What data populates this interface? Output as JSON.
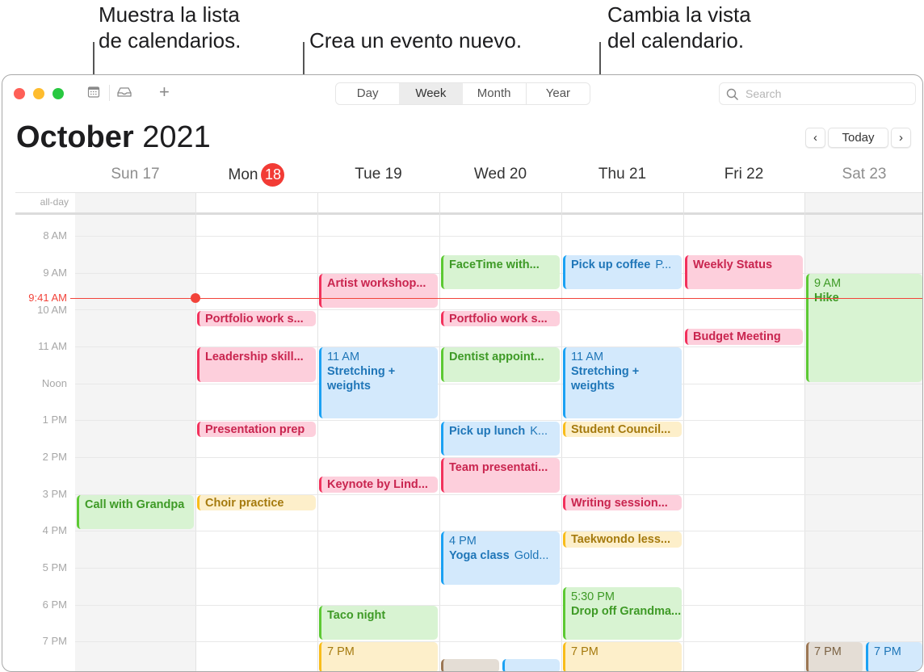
{
  "callouts": {
    "calendar_list": [
      "Muestra la lista",
      "de calendarios."
    ],
    "new_event": "Crea un evento nuevo.",
    "change_view": [
      "Cambia la vista",
      "del calendario."
    ]
  },
  "toolbar": {
    "view_options": [
      "Day",
      "Week",
      "Month",
      "Year"
    ],
    "active_view": "Week",
    "search_placeholder": "Search",
    "add_symbol": "+"
  },
  "header": {
    "month": "October",
    "year": "2021",
    "today_label": "Today",
    "prev_symbol": "‹",
    "next_symbol": "›"
  },
  "days": [
    {
      "label": "Sun 17",
      "weekend": true
    },
    {
      "label": "Mon",
      "badge": "18",
      "today": true
    },
    {
      "label": "Tue 19"
    },
    {
      "label": "Wed 20"
    },
    {
      "label": "Thu 21"
    },
    {
      "label": "Fri 22"
    },
    {
      "label": "Sat 23",
      "weekend": true
    }
  ],
  "all_day_label": "all-day",
  "hours": [
    "8 AM",
    "9 AM",
    "10 AM",
    "11 AM",
    "Noon",
    "1 PM",
    "2 PM",
    "3 PM",
    "4 PM",
    "5 PM",
    "6 PM",
    "7 PM"
  ],
  "current_time": "9:41 AM",
  "colors": {
    "pink": "#f2315c",
    "green": "#5cc933",
    "blue": "#1ba1f3",
    "yellow": "#f8bc1a",
    "brown": "#9b7653",
    "now": "#f2433a"
  },
  "events": [
    {
      "day": 0,
      "start": 15.05,
      "end": 16.0,
      "title": "Call with Grandpa",
      "color": "green"
    },
    {
      "day": 1,
      "start": 10.05,
      "end": 10.5,
      "title": "Portfolio work s...",
      "color": "pink"
    },
    {
      "day": 1,
      "start": 11.05,
      "end": 12.0,
      "title": "Leadership skill...",
      "color": "pink"
    },
    {
      "day": 1,
      "start": 13.05,
      "end": 13.5,
      "title": "Presentation prep",
      "color": "pink"
    },
    {
      "day": 1,
      "start": 15.05,
      "end": 15.5,
      "title": "Choir practice",
      "color": "yellow"
    },
    {
      "day": 2,
      "start": 9.05,
      "end": 10.0,
      "title": "Artist workshop...",
      "color": "pink"
    },
    {
      "day": 2,
      "start": 11.05,
      "end": 13.0,
      "time": "11 AM",
      "title": "Stretching + weights",
      "color": "blue",
      "wrap": true
    },
    {
      "day": 2,
      "start": 14.55,
      "end": 15.0,
      "title": "Keynote by Lind...",
      "color": "pink"
    },
    {
      "day": 2,
      "start": 18.05,
      "end": 19.0,
      "title": "Taco night",
      "color": "green"
    },
    {
      "day": 2,
      "start": 19.05,
      "end": 20.0,
      "time": "7 PM",
      "title": "",
      "color": "yellow"
    },
    {
      "day": 3,
      "start": 8.55,
      "end": 9.5,
      "title": "FaceTime with...",
      "color": "green"
    },
    {
      "day": 3,
      "start": 10.05,
      "end": 10.5,
      "title": "Portfolio work s...",
      "color": "pink"
    },
    {
      "day": 3,
      "start": 11.05,
      "end": 12.0,
      "title": "Dentist appoint...",
      "color": "green"
    },
    {
      "day": 3,
      "start": 13.05,
      "end": 14.0,
      "title": "Pick up lunch",
      "location": "K...",
      "color": "blue"
    },
    {
      "day": 3,
      "start": 14.05,
      "end": 15.0,
      "title": "Team presentati...",
      "color": "pink"
    },
    {
      "day": 3,
      "start": 16.05,
      "end": 17.5,
      "time": "4 PM",
      "title": "Yoga class",
      "location": "Gold...",
      "color": "blue"
    },
    {
      "day": 4,
      "start": 8.55,
      "end": 9.5,
      "title": "Pick up coffee",
      "location": "P...",
      "color": "blue"
    },
    {
      "day": 4,
      "start": 11.05,
      "end": 13.0,
      "time": "11 AM",
      "title": "Stretching + weights",
      "color": "blue",
      "wrap": true
    },
    {
      "day": 4,
      "start": 13.05,
      "end": 13.5,
      "title": "Student Council...",
      "color": "yellow"
    },
    {
      "day": 4,
      "start": 15.05,
      "end": 15.5,
      "title": "Writing session...",
      "color": "pink"
    },
    {
      "day": 4,
      "start": 16.05,
      "end": 16.5,
      "title": "Taekwondo less...",
      "color": "yellow"
    },
    {
      "day": 4,
      "start": 17.55,
      "end": 19.0,
      "time": "5:30 PM",
      "title": "Drop off Grandma...",
      "color": "green",
      "wrap": true
    },
    {
      "day": 4,
      "start": 19.05,
      "end": 20.0,
      "time": "7 PM",
      "title": "",
      "color": "yellow"
    },
    {
      "day": 5,
      "start": 8.55,
      "end": 9.5,
      "title": "Weekly Status",
      "color": "pink"
    },
    {
      "day": 5,
      "start": 10.55,
      "end": 11.0,
      "title": "Budget Meeting",
      "color": "pink"
    },
    {
      "day": 6,
      "start": 9.05,
      "end": 12.0,
      "time": "9 AM",
      "title": "Hike",
      "color": "green"
    },
    {
      "day": 6,
      "start": 19.05,
      "end": 20.0,
      "time": "7 PM",
      "title": "",
      "color": "brown",
      "half": 0
    },
    {
      "day": 6,
      "start": 19.05,
      "end": 20.0,
      "time": "7 PM",
      "title": "",
      "color": "blue",
      "half": 1
    },
    {
      "day": 3,
      "start": 19.5,
      "end": 20.0,
      "title": "",
      "color": "brown",
      "half": 0
    },
    {
      "day": 3,
      "start": 19.5,
      "end": 20.0,
      "title": "",
      "color": "blue",
      "half": 1
    }
  ]
}
